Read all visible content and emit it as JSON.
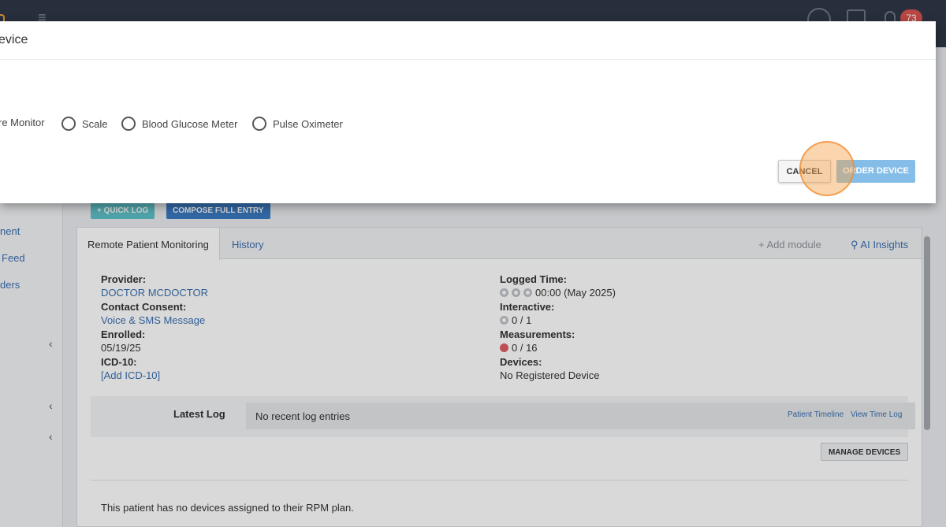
{
  "header": {
    "notification_count": "73",
    "icons": [
      "menu-collapse-icon",
      "search-icon",
      "add-icon",
      "bell-icon"
    ]
  },
  "sidebar": {
    "items": [
      {
        "label": "nent"
      },
      {
        "label": "Feed"
      },
      {
        "label": "ders"
      }
    ]
  },
  "toolbar": {
    "quick_log": "+ QUICK LOG",
    "compose_full_entry": "COMPOSE FULL ENTRY"
  },
  "tabs": {
    "rpm": "Remote Patient Monitoring",
    "history": "History",
    "add_module": "Add module",
    "ai_insights": "AI Insights"
  },
  "details_left": {
    "provider_label": "Provider:",
    "provider_value": "DOCTOR MCDOCTOR",
    "consent_label": "Contact Consent:",
    "consent_value": "Voice & SMS Message",
    "enrolled_label": "Enrolled:",
    "enrolled_value": "05/19/25",
    "icd_label": "ICD-10:",
    "icd_value": "[Add ICD-10]"
  },
  "details_right": {
    "logged_time_label": "Logged Time:",
    "logged_time_value": "00:00 (May 2025)",
    "interactive_label": "Interactive:",
    "interactive_value": "0 / 1",
    "measurements_label": "Measurements:",
    "measurements_value": "0 / 16",
    "devices_label": "Devices:",
    "devices_value": "No Registered Device"
  },
  "latest_log": {
    "label": "Latest Log",
    "text": "No recent log entries",
    "patient_timeline": "Patient Timeline",
    "view_time_log": "View Time Log"
  },
  "manage_devices": "MANAGE DEVICES",
  "no_devices_text": "This patient has no devices assigned to their RPM plan.",
  "modal": {
    "title": "evice",
    "options": [
      {
        "label": "re Monitor",
        "selected": false
      },
      {
        "label": "Scale",
        "selected": false
      },
      {
        "label": "Blood Glucose Meter",
        "selected": false
      },
      {
        "label": "Pulse Oximeter",
        "selected": false
      }
    ],
    "cancel": "CANCEL",
    "order": "ORDER DEVICE"
  },
  "colors": {
    "header_bg": "#2f3847",
    "link": "#3a6fb0",
    "order_button": "#84bde7",
    "badge": "#d9534f",
    "measurement_dot": "#e15b66",
    "click_highlight": "#f6a24a"
  }
}
